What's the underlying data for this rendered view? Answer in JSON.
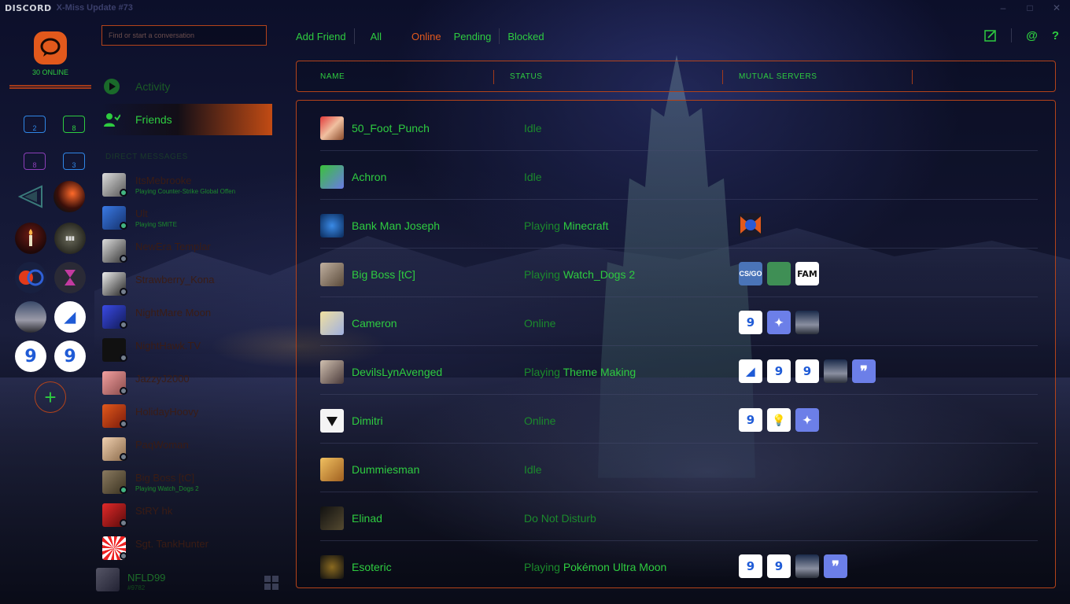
{
  "titlebar": {
    "brand": "DISCORD",
    "theme": "X-Miss Update #73",
    "controls": [
      "–",
      "□",
      "✕"
    ]
  },
  "guilds": {
    "online_count": "30 ONLINE",
    "folders": [
      {
        "count": "2",
        "color": "#2f86e6"
      },
      {
        "count": "8",
        "color": "#2ecc40"
      },
      {
        "count": "8",
        "color": "#8b3fb8"
      },
      {
        "count": "3",
        "color": "#2f86e6"
      }
    ]
  },
  "search": {
    "placeholder": "Find or start a conversation"
  },
  "nav": {
    "activity": "Activity",
    "friends": "Friends"
  },
  "dm_heading": "DIRECT MESSAGES",
  "dms": [
    {
      "name": "ItsMebrooke",
      "sub": "Playing Counter-Strike Global Offen",
      "status": "online"
    },
    {
      "name": "Ult",
      "sub": "Playing SMITE",
      "status": "online"
    },
    {
      "name": "NewEra Templar",
      "sub": "",
      "status": "offline"
    },
    {
      "name": "Strawberry_Kona",
      "sub": "",
      "status": "offline"
    },
    {
      "name": "NightMare Moon",
      "sub": "",
      "status": "offline"
    },
    {
      "name": "NightHawk.TV",
      "sub": "",
      "status": "offline"
    },
    {
      "name": "JazzyJ2000",
      "sub": "",
      "status": "offline"
    },
    {
      "name": "HolidayHoovy",
      "sub": "",
      "status": "offline"
    },
    {
      "name": "PaqWoman",
      "sub": "",
      "status": "offline"
    },
    {
      "name": "Big Boss [tC]",
      "sub": "Playing Watch_Dogs 2",
      "status": "online"
    },
    {
      "name": "StRY hk",
      "sub": "",
      "status": "offline"
    },
    {
      "name": "Sgt. TankHunter",
      "sub": "",
      "status": "offline"
    }
  ],
  "user": {
    "name": "NFLD99",
    "tag": "#9782"
  },
  "tabs": {
    "add_friend": "Add Friend",
    "all": "All",
    "online": "Online",
    "pending": "Pending",
    "blocked": "Blocked"
  },
  "columns": {
    "name": "NAME",
    "status": "STATUS",
    "mutual": "MUTUAL SERVERS"
  },
  "friends": [
    {
      "name": "50_Foot_Punch",
      "status_prefix": "",
      "status": "Idle",
      "servers": []
    },
    {
      "name": "Achron",
      "status_prefix": "",
      "status": "Idle",
      "servers": []
    },
    {
      "name": "Bank Man Joseph",
      "status_prefix": "Playing ",
      "status": "Minecraft",
      "servers": [
        "bx"
      ]
    },
    {
      "name": "Big Boss [tC]",
      "status_prefix": "Playing ",
      "status": "Watch_Dogs 2",
      "servers": [
        "cs",
        "duck",
        "fam"
      ]
    },
    {
      "name": "Cameron",
      "status_prefix": "",
      "status": "Online",
      "servers": [
        "nine",
        "snow",
        "mech"
      ]
    },
    {
      "name": "DevilsLynAvenged",
      "status_prefix": "Playing ",
      "status": "Theme Making",
      "servers": [
        "3d",
        "nine",
        "nine",
        "mech",
        "pok"
      ]
    },
    {
      "name": "Dimitri",
      "status_prefix": "",
      "status": "Online",
      "servers": [
        "nine",
        "bulb",
        "snow"
      ]
    },
    {
      "name": "Dummiesman",
      "status_prefix": "",
      "status": "Idle",
      "servers": []
    },
    {
      "name": "Elinad",
      "status_prefix": "",
      "status": "Do Not Disturb",
      "servers": []
    },
    {
      "name": "Esoteric",
      "status_prefix": "Playing ",
      "status": "Pokémon Ultra Moon",
      "servers": [
        "nine",
        "nine",
        "mech",
        "pok"
      ]
    }
  ],
  "server_glyphs": {
    "nine": "9",
    "pok": "❞",
    "cs": "CS/GO",
    "fam": "FAM",
    "3d": "◢",
    "snow": "✦",
    "bulb": "💡",
    "mech": "",
    "duck": "",
    "bx": ""
  },
  "colors": {
    "accent": "#2ecc40",
    "border": "#b3431a",
    "brand_orange": "#e2591c"
  }
}
